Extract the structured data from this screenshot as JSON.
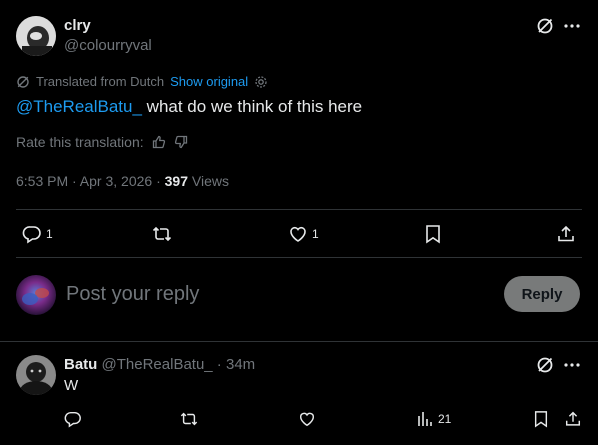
{
  "post": {
    "display_name": "clry",
    "handle": "@colourryval",
    "translated_from": "Translated from Dutch",
    "show_original": "Show original",
    "mention": "@TheRealBatu_",
    "text": " what do we think of this here",
    "rate_translation": "Rate this translation:",
    "time": "6:53 PM · Apr 3, 2026 · ",
    "views_count": "397",
    "views_label": " Views",
    "actions": {
      "reply_count": "1",
      "repost_count": "",
      "like_count": "1"
    }
  },
  "composer": {
    "placeholder": "Post your reply",
    "reply_button": "Reply"
  },
  "reply": {
    "display_name": "Batu",
    "handle": "@TheRealBatu_",
    "time": " · 34m",
    "text": "W",
    "views_count": "21"
  },
  "colors": {
    "background": "#000000",
    "text": "#e7e9ea",
    "muted": "#71767b",
    "link": "#1d9bf0",
    "divider": "#2f3336",
    "reply_button_bg": "#787a7a"
  }
}
